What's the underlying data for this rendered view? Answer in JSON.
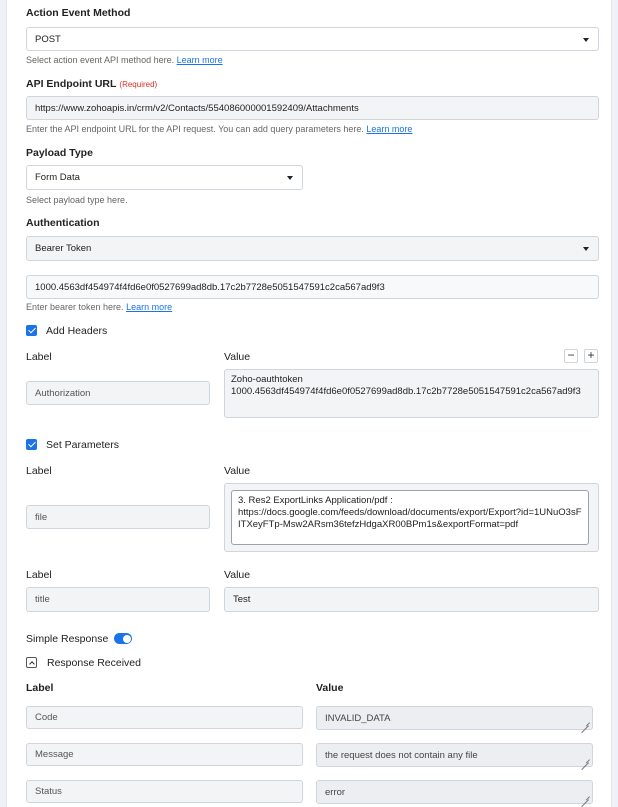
{
  "action_event_method": {
    "label": "Action Event Method",
    "value": "POST",
    "help": "Select action event API method here.",
    "help_link": "Learn more"
  },
  "api_endpoint": {
    "label": "API Endpoint URL",
    "required": "(Required)",
    "value": "https://www.zohoapis.in/crm/v2/Contacts/554086000001592409/Attachments",
    "help": "Enter the API endpoint URL for the API request. You can add query parameters here.",
    "help_link": "Learn more"
  },
  "payload_type": {
    "label": "Payload Type",
    "value": "Form Data",
    "help": "Select payload type here."
  },
  "authentication": {
    "label": "Authentication",
    "value": "Bearer Token",
    "token": "1000.4563df454974f4fd6e0f0527699ad8db.17c2b7728e5051547591c2ca567ad9f3",
    "help": "Enter bearer token here.",
    "help_link": "Learn more"
  },
  "headers": {
    "checkbox_label": "Add Headers",
    "label_header": "Label",
    "value_header": "Value",
    "minus": "−",
    "plus": "+",
    "rows": [
      {
        "label": "Authorization",
        "value_line1": "Zoho-oauthtoken",
        "value_line2": "1000.4563df454974f4fd6e0f0527699ad8db.17c2b7728e5051547591c2ca567ad9f3"
      }
    ]
  },
  "parameters": {
    "checkbox_label": "Set Parameters",
    "rows": [
      {
        "label_header": "Label",
        "value_header": "Value",
        "label": "file",
        "value_line1": "3. Res2 ExportLinks Application/pdf :",
        "value_line2": "https://docs.google.com/feeds/download/documents/export/Export?id=1UNuO3sFITXeyFTp-Msw2ARsm36tefzHdgaXR00BPm1s&exportFormat=pdf"
      },
      {
        "label_header": "Label",
        "value_header": "Value",
        "label": "title",
        "value": "Test"
      }
    ]
  },
  "simple_response": {
    "label": "Simple Response",
    "enabled": true
  },
  "response_received": {
    "label": "Response Received",
    "label_header": "Label",
    "value_header": "Value",
    "rows": [
      {
        "label": "Code",
        "value": "INVALID_DATA"
      },
      {
        "label": "Message",
        "value": "the request does not contain any file"
      },
      {
        "label": "Status",
        "value": "error"
      }
    ]
  },
  "colors": {
    "accent": "#1a73e8",
    "required": "#d93025",
    "field_grey": "#f3f4f6"
  }
}
